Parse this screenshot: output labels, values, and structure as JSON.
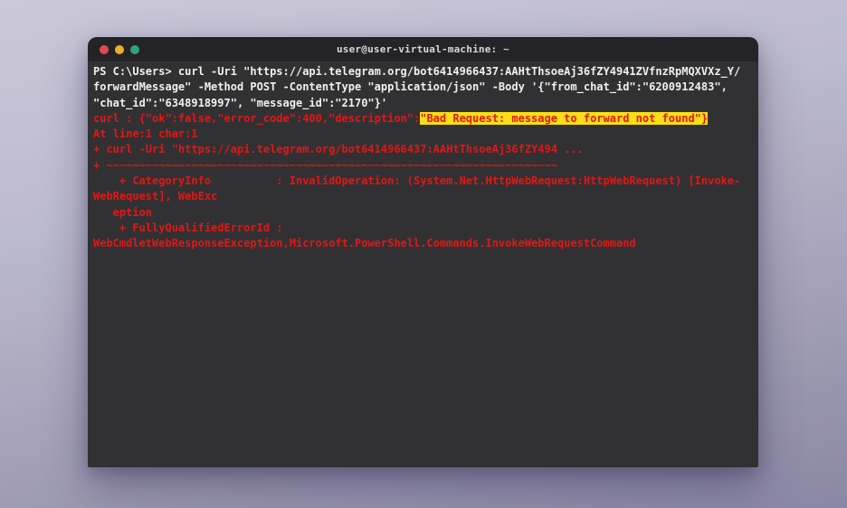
{
  "window": {
    "title": "user@user-virtual-machine: ~",
    "controls": {
      "close_color": "#dc4b52",
      "minimize_color": "#eeaf2f",
      "maximize_color": "#2fa37d"
    }
  },
  "colors": {
    "desktop_top": "#cac8d9",
    "desktop_bottom": "#8a87a4",
    "titlebar_bg": "#242427",
    "terminal_bg": "#313133",
    "command_text": "#f0f0ee",
    "error_text": "#e41616",
    "highlight_bg": "#fbdf16"
  },
  "terminal": {
    "lines": [
      {
        "style": "command",
        "text": "PS C:\\Users> curl -Uri \"https://api.telegram.org/bot6414966437:AAHtThsoeAj36fZY4941ZVfnzRpMQXVXz_Y/"
      },
      {
        "style": "command",
        "text": "forwardMessage\" -Method POST -ContentType \"application/json\" -Body '{\"from_chat_id\":\"6200912483\","
      },
      {
        "style": "command",
        "text": "\"chat_id\":\"6348918997\", \"message_id\":\"2170\"}'"
      },
      {
        "style": "error",
        "segments": [
          {
            "text": "curl : {\"ok\":false,\"error_code\":400,\"description\":"
          },
          {
            "text": "\"Bad Request: message to forward not found\"}",
            "highlight": true
          }
        ]
      },
      {
        "style": "error",
        "text": "At line:1 char:1"
      },
      {
        "style": "error",
        "text": "+ curl -Uri \"https://api.telegram.org/bot6414966437:AAHtThsoeAj36fZY494 ..."
      },
      {
        "style": "error",
        "text": "+ ~~~~~~~~~~~~~~~~~~~~~~~~~~~~~~~~~~~~~~~~~~~~~~~~~~~~~~~~~~~~~~~~~~~~~"
      },
      {
        "style": "error",
        "text": "    + CategoryInfo          : InvalidOperation: (System.Net.HttpWebRequest:HttpWebRequest) [Invoke-"
      },
      {
        "style": "error",
        "text": "WebRequest], WebExc"
      },
      {
        "style": "error",
        "text": "   eption"
      },
      {
        "style": "error",
        "text": "    + FullyQualifiedErrorId :"
      },
      {
        "style": "error",
        "text": "WebCmdletWebResponseException,Microsoft.PowerShell.Commands.InvokeWebRequestCommand"
      }
    ]
  }
}
